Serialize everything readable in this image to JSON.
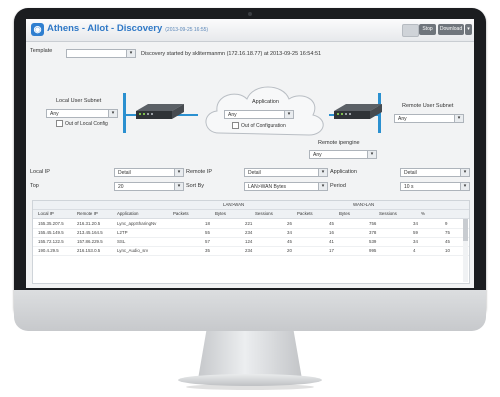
{
  "app": {
    "title": "Athens - Allot - Discovery",
    "timestamp": "(2013-09-25 16:55)"
  },
  "toolbar": {
    "stop_label": "Stop",
    "download_label": "Download",
    "more_label": "▾"
  },
  "template": {
    "label": "Template",
    "value": ""
  },
  "discovery_status": "Discovery started by sklitermanmn (172.16.18.77) at 2013-09-25 16:54:51",
  "local_subnet": {
    "label": "Local User Subnet",
    "value": "Any",
    "checkbox_label": "Out of Local Config"
  },
  "application_box": {
    "label": "Application",
    "value": "Any",
    "checkbox_label": "Out of Configuration"
  },
  "remote_subnet": {
    "label": "Remote User Subnet",
    "value": "Any"
  },
  "remote_engine": {
    "label": "Remote ipengine",
    "value": "Any"
  },
  "filters": {
    "local_ip": {
      "label": "Local IP",
      "value": "Detail"
    },
    "remote_ip": {
      "label": "Remote IP",
      "value": "Detail"
    },
    "application": {
      "label": "Application",
      "value": "Detail"
    },
    "top": {
      "label": "Top",
      "value": "20"
    },
    "sort_by": {
      "label": "Sort By",
      "value": "LAN>WAN Bytes"
    },
    "period": {
      "label": "Period",
      "value": "10 s"
    }
  },
  "table": {
    "group_headers": [
      "LAN>WAN",
      "WAN>LAN"
    ],
    "columns": [
      "Local IP",
      "Remote IP",
      "Application",
      "Packets",
      "Bytes",
      "Sessions",
      "Packets",
      "Bytes",
      "Sessions",
      "%"
    ],
    "rows": [
      [
        "155.35.207.5",
        "216.31.20.5",
        "Lync_appSharingNv",
        "18",
        "221",
        "26",
        "45",
        "756",
        "34",
        "9"
      ],
      [
        "155.45.149.5",
        "213.45.164.5",
        "L2TP",
        "55",
        "234",
        "34",
        "16",
        "378",
        "59",
        "75"
      ],
      [
        "155.72.122.5",
        "157.86.229.5",
        "SSL",
        "57",
        "124",
        "45",
        "41",
        "539",
        "34",
        "45"
      ],
      [
        "190.4.29.5",
        "216.153.0.5",
        "Lync_Audio_srv",
        "35",
        "234",
        "20",
        "17",
        "995",
        "4",
        "10"
      ]
    ]
  },
  "colors": {
    "accent": "#2b90d0",
    "title": "#2f78c6"
  }
}
